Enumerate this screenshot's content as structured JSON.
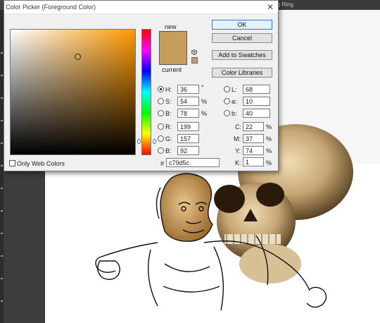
{
  "dialog": {
    "title": "Color Picker (Foreground Color)",
    "close_icon": "close-icon"
  },
  "background": {
    "tab_title": "g Ring"
  },
  "preview": {
    "new_label": "new",
    "current_label": "current",
    "new_color": "#c79d5c",
    "current_color": "#c79d5c",
    "cube_icon": "websafe-cube-icon"
  },
  "buttons": {
    "ok": "OK",
    "cancel": "Cancel",
    "add_to_swatches": "Add to Swatches",
    "color_libraries": "Color Libraries"
  },
  "fields": {
    "h": {
      "label": "H:",
      "value": "36",
      "unit": "°",
      "selected": true
    },
    "s": {
      "label": "S:",
      "value": "54",
      "unit": "%"
    },
    "b": {
      "label": "B:",
      "value": "78",
      "unit": "%"
    },
    "r": {
      "label": "R:",
      "value": "199"
    },
    "g": {
      "label": "G:",
      "value": "157"
    },
    "bl": {
      "label": "B:",
      "value": "92"
    },
    "l": {
      "label": "L:",
      "value": "68"
    },
    "a": {
      "label": "a:",
      "value": "10"
    },
    "lb": {
      "label": "b:",
      "value": "40"
    },
    "c": {
      "label": "C:",
      "value": "22",
      "unit": "%"
    },
    "m": {
      "label": "M:",
      "value": "37",
      "unit": "%"
    },
    "y": {
      "label": "Y:",
      "value": "74",
      "unit": "%"
    },
    "k": {
      "label": "K:",
      "value": "1",
      "unit": "%"
    },
    "hex": {
      "label": "#",
      "value": "c79d5c"
    }
  },
  "only_web_colors": {
    "label": "Only Web Colors",
    "checked": false
  },
  "colors": {
    "hue_base": "#ff9900",
    "accent": "#2a7cd6"
  }
}
